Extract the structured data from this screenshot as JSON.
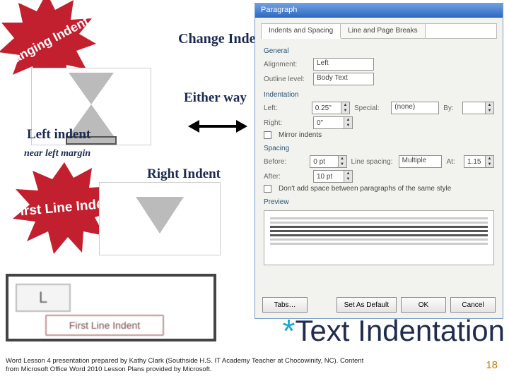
{
  "badges": {
    "hanging": "Hanging Indent",
    "firstLine": "First Line Indent"
  },
  "annotations": {
    "change": "Change Indents",
    "either": "Either way",
    "leftIndent": "Left indent",
    "nearLeft": "near left margin",
    "rightIndent": "Right Indent"
  },
  "dialog": {
    "title": "Paragraph",
    "tabs": {
      "t1": "Indents and Spacing",
      "t2": "Line and Page Breaks"
    },
    "general": {
      "heading": "General",
      "alignmentLabel": "Alignment:",
      "alignmentValue": "Left",
      "outlineLabel": "Outline level:",
      "outlineValue": "Body Text"
    },
    "indentation": {
      "heading": "Indentation",
      "leftLabel": "Left:",
      "leftValue": "0.25\"",
      "rightLabel": "Right:",
      "rightValue": "0\"",
      "specialLabel": "Special:",
      "specialValue": "(none)",
      "byLabel": "By:",
      "byValue": "",
      "mirror": "Mirror indents"
    },
    "spacing": {
      "heading": "Spacing",
      "beforeLabel": "Before:",
      "beforeValue": "0 pt",
      "afterLabel": "After:",
      "afterValue": "10 pt",
      "lineSpacingLabel": "Line spacing:",
      "lineSpacingValue": "Multiple",
      "atLabel": "At:",
      "atValue": "1.15",
      "noSpace": "Don't add space between paragraphs of the same style"
    },
    "previewHeading": "Preview",
    "buttons": {
      "tabs": "Tabs…",
      "default": "Set As Default",
      "ok": "OK",
      "cancel": "Cancel"
    }
  },
  "markerTooltip": {
    "l": "L",
    "label": "First Line Indent"
  },
  "title": {
    "asterisk": "*",
    "text": "Text Indentation"
  },
  "footer": {
    "credit": "Word Lesson 4 presentation prepared by Kathy Clark (Southside H.S. IT Academy Teacher at Chocowinity, NC). Content from Microsoft Office Word 2010 Lesson Plans provided by Microsoft.",
    "slide": "18"
  }
}
